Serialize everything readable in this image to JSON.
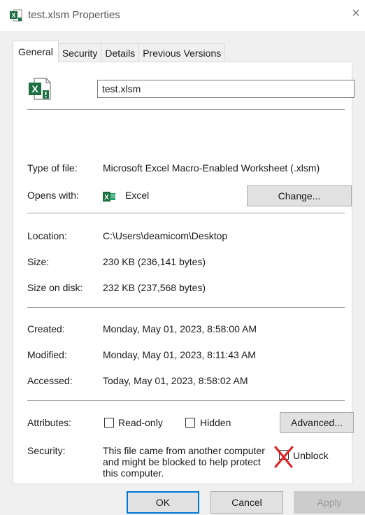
{
  "window": {
    "title": "test.xlsm Properties",
    "close_glyph": "×"
  },
  "tabs": [
    {
      "label": "General",
      "active": true
    },
    {
      "label": "Security",
      "active": false
    },
    {
      "label": "Details",
      "active": false
    },
    {
      "label": "Previous Versions",
      "active": false
    }
  ],
  "general": {
    "file_name": "test.xlsm",
    "type_of_file": {
      "label": "Type of file:",
      "value": "Microsoft Excel Macro-Enabled Worksheet (.xlsm)"
    },
    "opens_with": {
      "label": "Opens with:",
      "value": "Excel",
      "change_label": "Change..."
    },
    "location": {
      "label": "Location:",
      "value": "C:\\Users\\deamicom\\Desktop"
    },
    "size": {
      "label": "Size:",
      "value": "230 KB (236,141 bytes)"
    },
    "size_on_disk": {
      "label": "Size on disk:",
      "value": "232 KB (237,568 bytes)"
    },
    "created": {
      "label": "Created:",
      "value": "Monday, May 01, 2023, 8:58:00 AM"
    },
    "modified": {
      "label": "Modified:",
      "value": "Monday, May 01, 2023, 8:11:43 AM"
    },
    "accessed": {
      "label": "Accessed:",
      "value": "Today, May 01, 2023, 8:58:02 AM"
    },
    "attributes": {
      "label": "Attributes:",
      "read_only": "Read-only",
      "hidden": "Hidden",
      "advanced_label": "Advanced..."
    },
    "security": {
      "label": "Security:",
      "text": "This file came from another computer and might be blocked to help protect this computer.",
      "unblock": "Unblock"
    }
  },
  "buttons": {
    "ok": "OK",
    "cancel": "Cancel",
    "apply": "Apply"
  },
  "colors": {
    "excel_green": "#1d6f42",
    "cross_red": "#e02020"
  },
  "icons": {
    "title": "excel-file-icon",
    "big": "excel-macro-file-icon",
    "opens_with": "excel-app-icon",
    "unblock_annotation": "red-x-mark-icon"
  }
}
